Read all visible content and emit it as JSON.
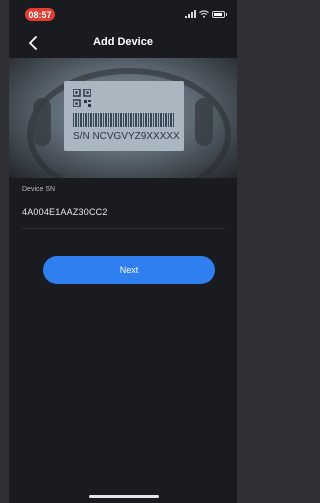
{
  "status_bar": {
    "time": "08:57"
  },
  "nav": {
    "back_icon": "chevron-left-icon",
    "title": "Add Device"
  },
  "hero": {
    "serial_text": "S/N NCVGVYZ9XXXXX"
  },
  "form": {
    "label": "Device SN",
    "value": "4A004E1AAZ30CC2"
  },
  "actions": {
    "next_label": "Next"
  },
  "colors": {
    "accent": "#2f7ff0",
    "time_pill": "#e23b30",
    "background": "#1a1b20"
  }
}
